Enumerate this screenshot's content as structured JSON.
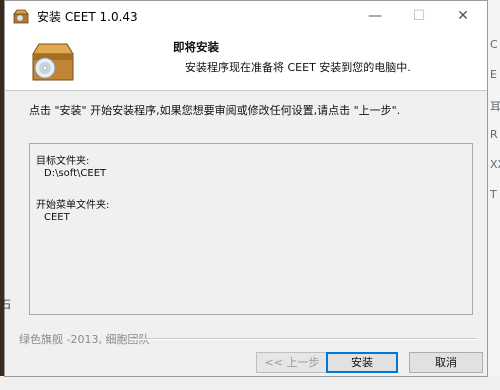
{
  "window": {
    "title": "安装 CEET 1.0.43",
    "controls": {
      "minimize": "—",
      "maximize": "☐",
      "close": "✕"
    }
  },
  "header": {
    "title": "即将安装",
    "subtitle": "安装程序现在准备将 CEET 安装到您的电脑中."
  },
  "instruction": "点击 \"安装\" 开始安装程序,如果您想要审阅或修改任何设置,请点击 \"上一步\".",
  "summary": {
    "target_folder_label": "目标文件夹:",
    "target_folder_value": "D:\\soft\\CEET",
    "start_menu_label": "开始菜单文件夹:",
    "start_menu_value": "CEET"
  },
  "branding": "绿色旗舰 -2013, 细胞团队",
  "buttons": {
    "back": "<< 上一步",
    "install": "安装",
    "cancel": "取消"
  },
  "background_right_chars": [
    "C",
    "E",
    "耳",
    "R",
    "XX",
    "T"
  ],
  "background_left_char": "石",
  "colors": {
    "accent": "#0078d7"
  }
}
